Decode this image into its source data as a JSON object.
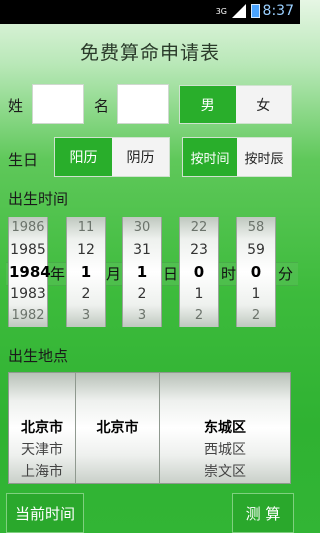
{
  "status": {
    "time": "8:37",
    "network": "3G"
  },
  "title": "免费算命申请表",
  "surname_label": "姓",
  "name_label": "名",
  "gender": {
    "male": "男",
    "female": "女",
    "selected": "male"
  },
  "birthday_label": "生日",
  "calendar": {
    "solar": "阳历",
    "lunar": "阴历",
    "selected": "solar"
  },
  "time_mode": {
    "by_time": "按时间",
    "by_hour": "按时辰",
    "selected": "by_time"
  },
  "birth_time_label": "出生时间",
  "year_wheel": [
    "1986",
    "1985",
    "1984",
    "1983",
    "1982"
  ],
  "month_wheel": [
    "11",
    "12",
    "1",
    "2",
    "3"
  ],
  "day_wheel": [
    "30",
    "31",
    "1",
    "2",
    "3"
  ],
  "hour_wheel": [
    "22",
    "23",
    "0",
    "1",
    "2"
  ],
  "minute_wheel": [
    "58",
    "59",
    "0",
    "1",
    "2"
  ],
  "units": {
    "year": "年",
    "month": "月",
    "day": "日",
    "hour": "时",
    "minute": "分"
  },
  "birth_place_label": "出生地点",
  "province_wheel": [
    "",
    "",
    "北京市",
    "天津市",
    "上海市"
  ],
  "city_wheel": [
    "",
    "",
    "北京市",
    "",
    ""
  ],
  "district_wheel": [
    "",
    "",
    "东城区",
    "西城区",
    "崇文区"
  ],
  "current_time_button": "当前时间",
  "calculate_button": "测 算"
}
